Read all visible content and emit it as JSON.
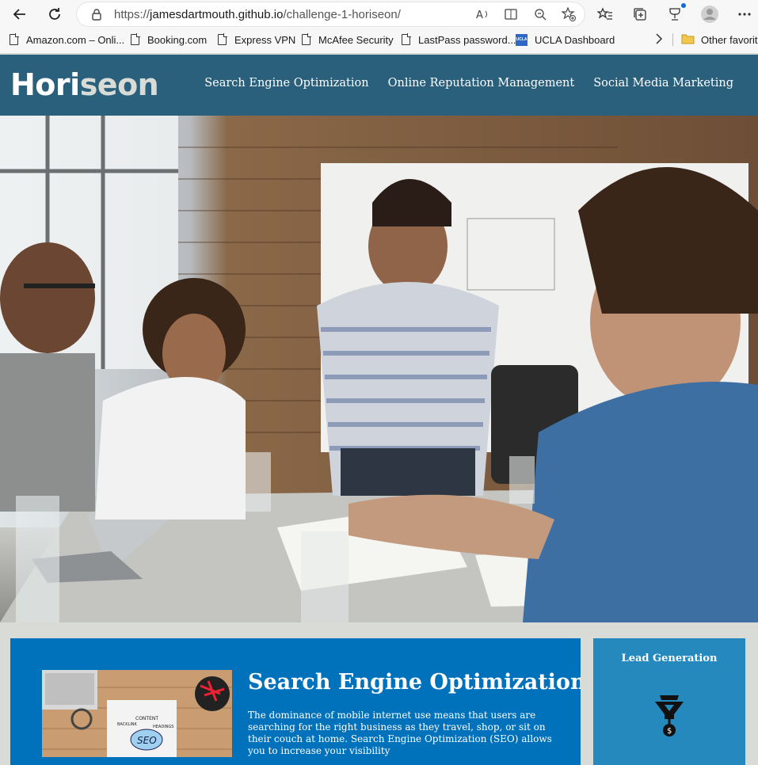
{
  "browser": {
    "url_prefix": "https://",
    "url_host": "jamesdartmouth.github.io",
    "url_path": "/challenge-1-horiseon/",
    "bookmarks": [
      {
        "label": "Amazon.com – Onli..."
      },
      {
        "label": "Booking.com"
      },
      {
        "label": "Express VPN"
      },
      {
        "label": "McAfee Security"
      },
      {
        "label": "LastPass password..."
      },
      {
        "label": "UCLA Dashboard"
      }
    ],
    "other_favorites": "Other favorite",
    "ucla_badge": "UCLA"
  },
  "site": {
    "logo_a": "Hori",
    "logo_b": "seon",
    "nav": [
      {
        "label": "Search Engine Optimization"
      },
      {
        "label": "Online Reputation Management"
      },
      {
        "label": "Social Media Marketing"
      }
    ],
    "colors": {
      "header": "#2a607c",
      "page_bg": "#d9dcd6",
      "content_bg": "#0072bb",
      "benefit_bg": "#2589bd"
    }
  },
  "content": {
    "title": "Search Engine Optimization",
    "body": "The dominance of mobile internet use means that users are searching for the right business as they travel, shop, or sit on their couch at home. Search Engine Optimization (SEO) allows you to increase your visibility",
    "thumb_labels": {
      "content": "CONTENT",
      "headings": "HEADINGS",
      "backlink": "BACKLINK",
      "seo": "SEO"
    }
  },
  "benefits": {
    "title": "Lead Generation"
  }
}
